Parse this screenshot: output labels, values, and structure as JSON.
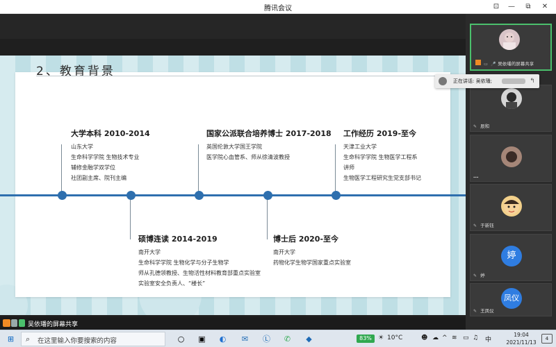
{
  "window": {
    "title": "腾讯会议",
    "controls": {
      "pin": "⊡",
      "minimize": "—",
      "maximize": "⧉",
      "close": "✕"
    }
  },
  "slide": {
    "title": "2、教育背景",
    "blocks": [
      {
        "id": "undergrad",
        "heading": "大学本科  2010-2014",
        "lines": [
          "山东大学",
          "生命科学学院 生物技术专业",
          "辅修金融学双学位",
          "社团副主席、院刊主编"
        ]
      },
      {
        "id": "masters-phd",
        "heading": "硕博连读 2014-2019",
        "lines": [
          "南开大学",
          "生命科学学院 生物化学与分子生物学",
          "师从孔德领教授、生物活性材料教育部重点实验室",
          "实验室安全负责人、“楼长”"
        ]
      },
      {
        "id": "joint-phd",
        "heading": "国家公派联合培养博士 2017-2018",
        "lines": [
          "英国伦敦大学国王学院",
          "医学院心血管系、师从徐清波教授"
        ]
      },
      {
        "id": "postdoc",
        "heading": "博士后 2020-至今",
        "lines": [
          "南开大学",
          "药物化学生物学国家重点实验室"
        ]
      },
      {
        "id": "work",
        "heading": "工作经历 2019-至今",
        "lines": [
          "天津工业大学",
          "生命科学学院 生物医学工程系",
          "讲师",
          "生物医学工程研究生党支部书记"
        ]
      }
    ]
  },
  "participants": [
    {
      "name": "吴依璠的屏幕共享",
      "avatar": "photo",
      "active": true
    },
    {
      "name": "辰和",
      "avatar": "photo"
    },
    {
      "name": "...",
      "avatar": "photo"
    },
    {
      "name": "于新钰",
      "avatar": "cartoon"
    },
    {
      "name": "婷",
      "avatar": "婷"
    },
    {
      "name": "王凤仪",
      "avatar": "凤仪"
    }
  ],
  "speaking": {
    "label": "正在讲话: 吴依璠;"
  },
  "share_bar": {
    "label": "吴依璠的屏幕共享"
  },
  "taskbar": {
    "search_placeholder": "在这里输入你要搜索的内容",
    "battery": "83%",
    "weather": "10°C",
    "ime": "中",
    "time": "19:04",
    "date": "2021/11/13",
    "notifications": "4",
    "colors": {
      "accent": "#2e6fae",
      "active_border": "#4bc06c",
      "avatar_blue": "#2f7de1"
    }
  }
}
